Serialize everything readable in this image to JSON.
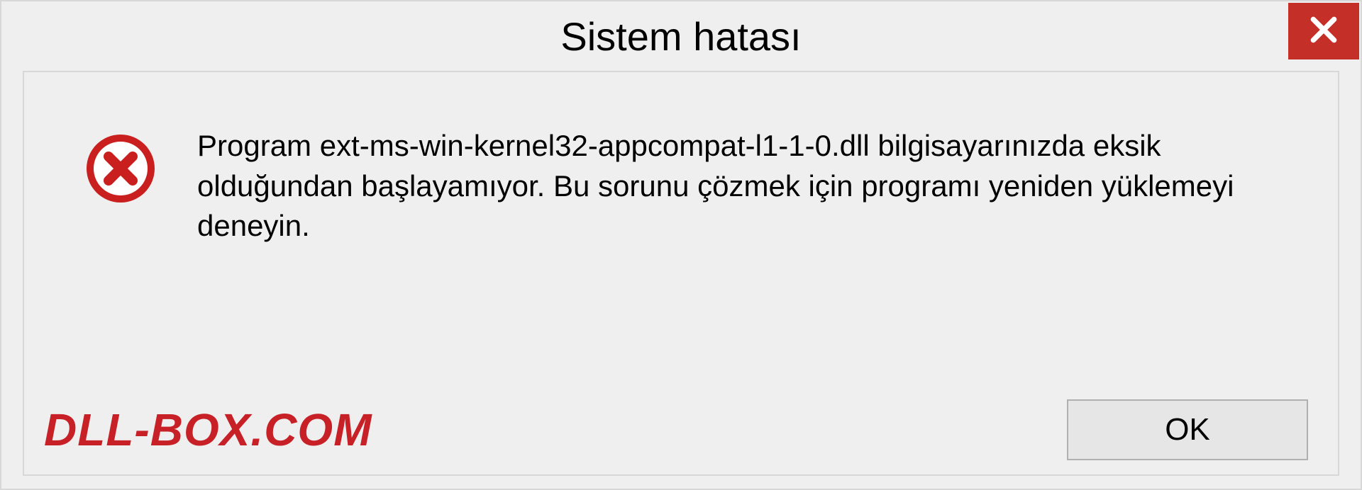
{
  "dialog": {
    "title": "Sistem hatası",
    "message": "Program ext-ms-win-kernel32-appcompat-l1-1-0.dll bilgisayarınızda eksik olduğundan başlayamıyor. Bu sorunu çözmek için programı yeniden yüklemeyi deneyin.",
    "ok_label": "OK",
    "watermark": "DLL-BOX.COM"
  }
}
